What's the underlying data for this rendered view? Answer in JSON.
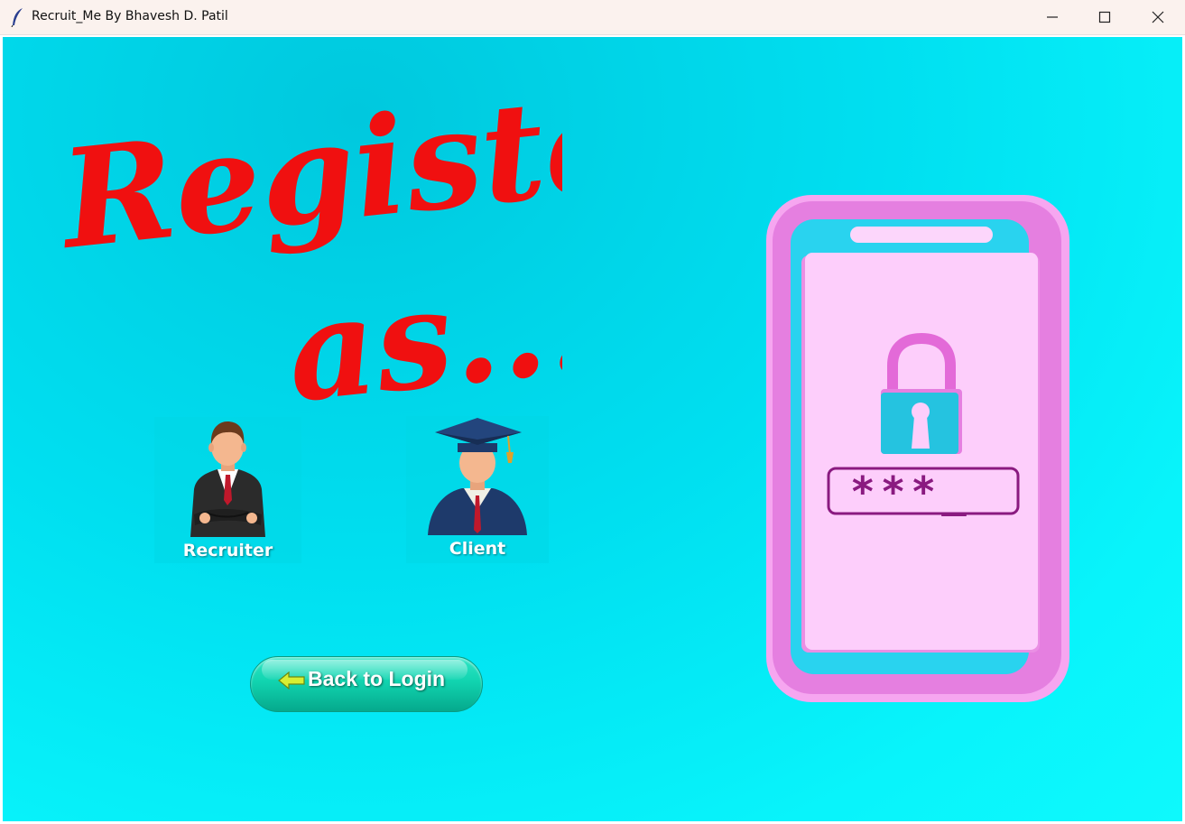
{
  "window": {
    "title": "Recruit_Me By Bhavesh D. Patil",
    "controls": [
      "minimize",
      "maximize",
      "close"
    ]
  },
  "heading": {
    "line1": "Register",
    "line2": "as...",
    "color": "#f01010"
  },
  "roles": [
    {
      "label": "Recruiter",
      "icon": "businessman-icon"
    },
    {
      "label": "Client",
      "icon": "graduate-icon"
    }
  ],
  "back_button": {
    "label": "Back to Login",
    "icon": "arrow-left-icon"
  },
  "illustration": {
    "password_mask": "***_",
    "icon": "padlock-icon"
  },
  "colors": {
    "background": "#00e6f5",
    "accent_red": "#f01010",
    "button_green": "#11d4b0",
    "phone_pink": "#f6a6f0"
  }
}
